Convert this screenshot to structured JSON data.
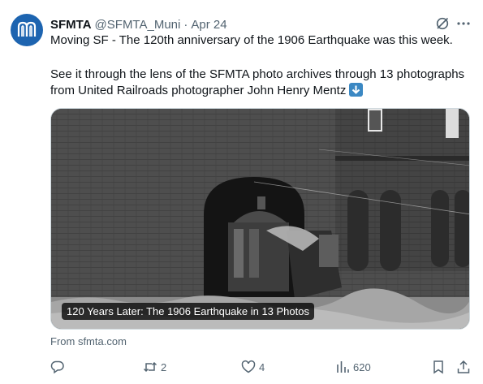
{
  "author": {
    "name": "SFMTA",
    "handle": "@SFMTA_Muni",
    "separator": "·",
    "date": "Apr 24"
  },
  "tweet": {
    "line1": "Moving SF - The 120th anniversary of the 1906 Earthquake was this week.",
    "line2": "See it through the lens of the SFMTA photo archives through 13 photographs",
    "line3": "from United Railroads photographer John Henry Mentz",
    "emoji": "down-arrow-emoji"
  },
  "media": {
    "caption": "120 Years Later: The 1906 Earthquake in 13 Photos",
    "description": "black-and-white photo of a damaged cable car in a brick building archway"
  },
  "link": {
    "source": "From sfmta.com"
  },
  "actions": {
    "reply_count": "",
    "retweet_count": "2",
    "like_count": "4",
    "views_count": "620"
  },
  "icons": [
    "muni-logo-icon",
    "grok-icon",
    "more-icon",
    "reply-icon",
    "retweet-icon",
    "like-icon",
    "views-icon",
    "bookmark-icon",
    "share-icon"
  ],
  "colors": {
    "text": "#0f1419",
    "secondary": "#536471",
    "avatar": "#1d64b0",
    "border": "#cfd9de"
  }
}
